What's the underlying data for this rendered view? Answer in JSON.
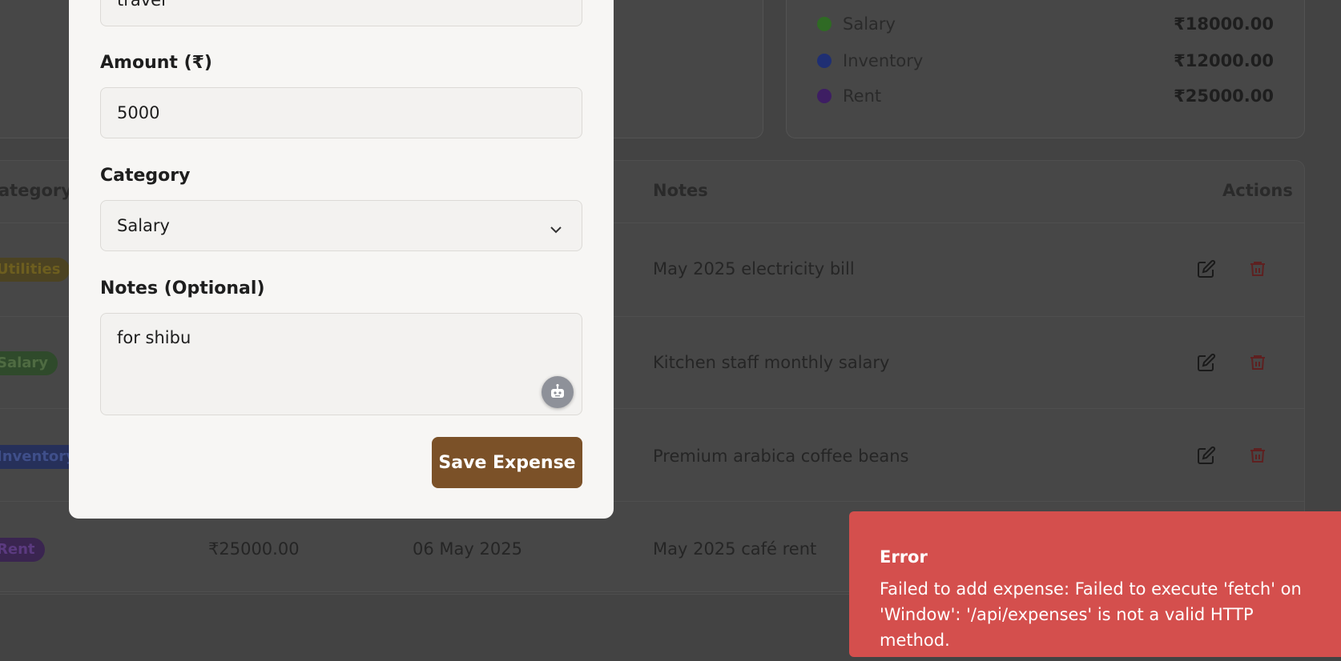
{
  "modal": {
    "title_field_value": "travel",
    "amount_label": "Amount (₹)",
    "amount_value": "5000",
    "category_label": "Category",
    "category_value": "Salary",
    "notes_label": "Notes (Optional)",
    "notes_value": "for shibu",
    "save_label": "Save Expense",
    "ai_icon": "robot-icon"
  },
  "summary": {
    "legend": [
      {
        "label": "Salary",
        "amount": "₹18000.00",
        "color": "#2f6a24"
      },
      {
        "label": "Inventory",
        "amount": "₹12000.00",
        "color": "#1f2f73"
      },
      {
        "label": "Rent",
        "amount": "₹25000.00",
        "color": "#3e1e63"
      }
    ]
  },
  "table": {
    "headers": {
      "category": "ategory",
      "notes": "Notes",
      "actions": "Actions"
    },
    "rows": [
      {
        "category": "Utilities",
        "amount": "",
        "date": "",
        "notes": "May 2025 electricity bill"
      },
      {
        "category": "Salary",
        "amount": "",
        "date": "",
        "notes": "Kitchen staff monthly salary"
      },
      {
        "category": "Inventory",
        "amount": "",
        "date": "",
        "notes": "Premium arabica coffee beans"
      },
      {
        "category": "Rent",
        "amount": "₹25000.00",
        "date": "06 May 2025",
        "notes": "May 2025 café rent"
      }
    ]
  },
  "toast": {
    "title": "Error",
    "message": "Failed to add expense: Failed to execute 'fetch' on 'Window': '/api/expenses' is not a valid HTTP method."
  },
  "colors": {
    "accent": "#7b5128",
    "error": "#d44f4d"
  }
}
